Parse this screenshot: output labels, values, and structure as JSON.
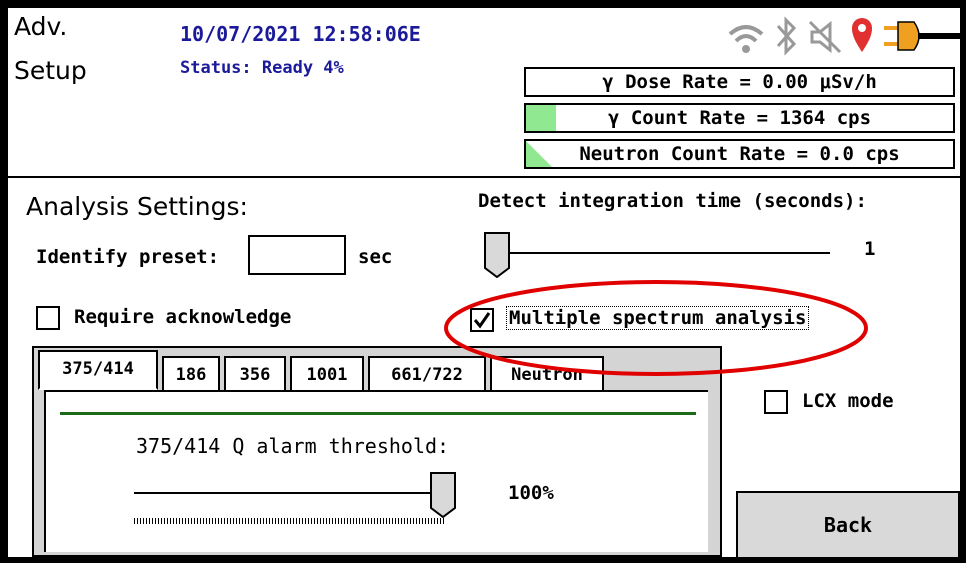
{
  "header": {
    "title_line1": "Adv.",
    "title_line2": "Setup",
    "datetime": "10/07/2021 12:58:06E",
    "status": "Status: Ready 4%",
    "icons": [
      "wifi-icon",
      "bluetooth-icon",
      "mute-icon",
      "location-pin-icon",
      "power-plug-icon"
    ],
    "rates": {
      "gamma_dose": "γ Dose Rate = 0.00  μSv/h",
      "gamma_count": "γ Count Rate = 1364 cps",
      "neutron_count": "Neutron Count Rate = 0.0 cps"
    },
    "colors": {
      "accent_blue": "#1a1a9a",
      "bar_green": "#90e890",
      "pin_red": "#e03030",
      "plug_orange": "#f0a020"
    }
  },
  "analysis": {
    "heading": "Analysis Settings:",
    "identify_preset_label": "Identify preset:",
    "identify_preset_value": "",
    "identify_preset_unit": "sec",
    "require_ack_label": "Require acknowledge",
    "require_ack_checked": false,
    "integration_label": "Detect integration time (seconds):",
    "integration_value": "1",
    "integration_slider_fraction": 0.0,
    "multi_spectrum_label": "Multiple spectrum analysis",
    "multi_spectrum_checked": true,
    "lcx_label": "LCX mode",
    "lcx_checked": false
  },
  "tabs": {
    "items": [
      "375/414",
      "186",
      "356",
      "1001",
      "661/722",
      "Neutron"
    ],
    "active": 0
  },
  "panel": {
    "threshold_label": "375/414 Q alarm threshold:",
    "threshold_value": "100%",
    "threshold_fraction": 1.0,
    "divider_color": "#1a6a1a"
  },
  "buttons": {
    "back": "Back"
  },
  "annotation": {
    "ellipse_color": "#e00000"
  }
}
